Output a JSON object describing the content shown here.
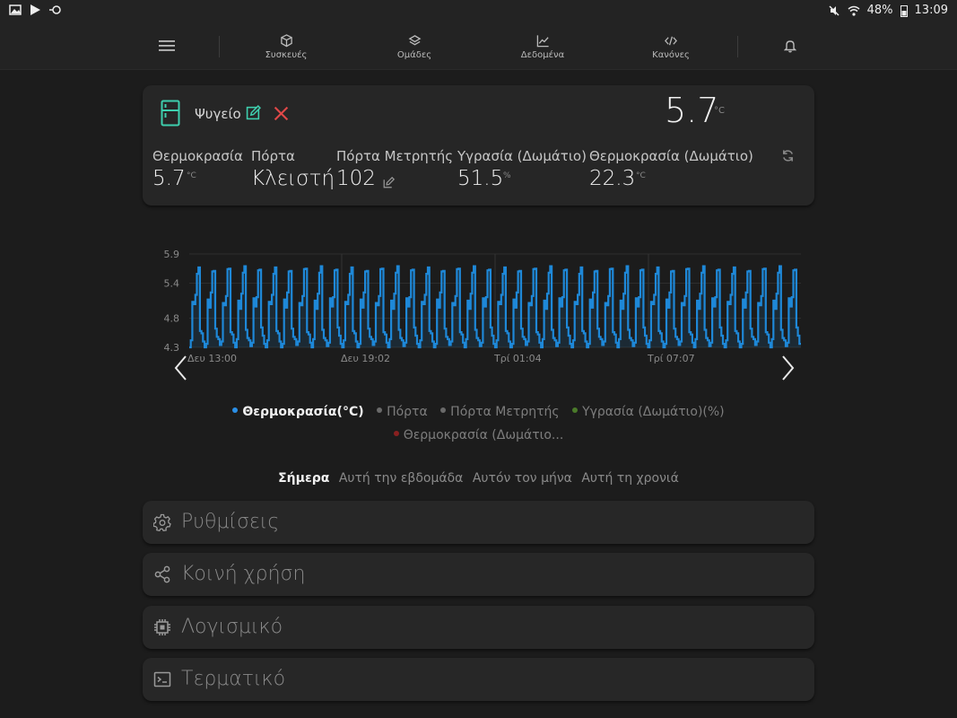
{
  "status": {
    "battery": "48%",
    "time": "13:09"
  },
  "nav": {
    "devices": "Συσκευές",
    "groups": "Ομάδες",
    "data": "Δεδομένα",
    "rules": "Κανόνες"
  },
  "device": {
    "name": "Ψυγείο",
    "main_value": "5.7",
    "main_unit": "°C",
    "metrics": [
      {
        "label": "Θερμοκρασία",
        "value": "5.7",
        "unit": "°C"
      },
      {
        "label": "Πόρτα",
        "value": "Κλειστή",
        "unit": ""
      },
      {
        "label": "Πόρτα Μετρητής",
        "value": "102",
        "unit": ""
      },
      {
        "label": "Υγρασία (Δωμάτιο)",
        "value": "51.5",
        "unit": "%"
      },
      {
        "label": "Θερμοκρασία (Δωμάτιο)",
        "value": "22.3",
        "unit": "°C"
      }
    ]
  },
  "chart_data": {
    "type": "line",
    "ylim": [
      4.3,
      5.9
    ],
    "yticks": [
      "5.9",
      "5.4",
      "4.8",
      "4.3"
    ],
    "xticks": [
      "Δευ 13:00",
      "Δευ 19:02",
      "Τρί 01:04",
      "Τρί 07:07"
    ],
    "series": [
      {
        "name": "Θερμοκρασία(°C)",
        "color": "#1e88d8",
        "pattern": [
          4.3,
          4.4,
          5.1,
          5.0,
          5.2,
          5.6,
          5.65,
          4.6,
          4.5,
          4.4
        ]
      }
    ]
  },
  "legend": [
    {
      "label": "Θερμοκρασία(°C)",
      "color": "#2b8fe6",
      "active": true
    },
    {
      "label": "Πόρτα",
      "color": "#6a6a6a",
      "active": false
    },
    {
      "label": "Πόρτα Μετρητής",
      "color": "#6a6a6a",
      "active": false
    },
    {
      "label": "Υγρασία (Δωμάτιο)(%)",
      "color": "#4a7a2a",
      "active": false
    },
    {
      "label": "Θερμοκρασία (Δωμάτιο...",
      "color": "#8a2020",
      "active": false
    }
  ],
  "ranges": [
    "Σήμερα",
    "Αυτή την εβδομάδα",
    "Αυτόν τον μήνα",
    "Αυτή τη χρονιά"
  ],
  "sections": {
    "settings": "Ρυθμίσεις",
    "sharing": "Κοινή χρήση",
    "software": "Λογισμικό",
    "terminal": "Τερματικό"
  },
  "colors": {
    "accent": "#3ecfae",
    "delete": "#e04848",
    "series": "#1e88d8"
  }
}
